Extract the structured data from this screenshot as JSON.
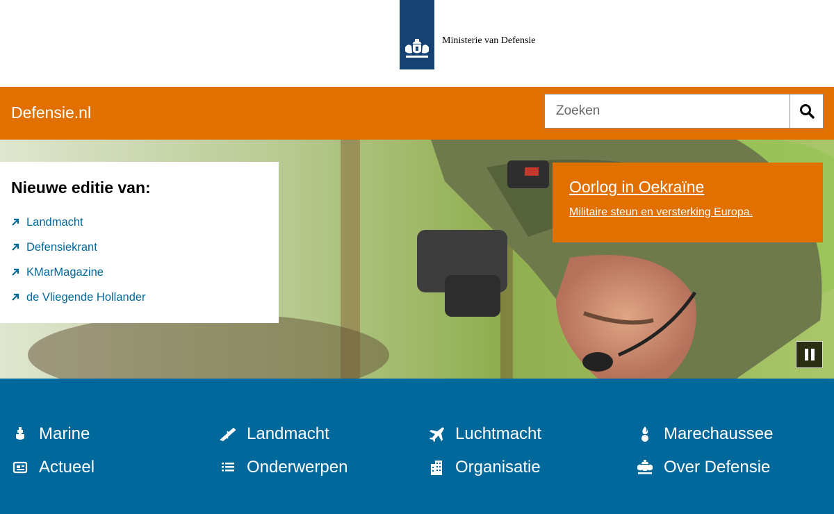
{
  "header": {
    "logo_text": "Ministerie van Defensie"
  },
  "navbar": {
    "site_title": "Defensie.nl",
    "search_placeholder": "Zoeken",
    "search_button_icon": "search-icon"
  },
  "hero": {
    "magazines_title": "Nieuwe editie van:",
    "magazines": [
      {
        "label": "Landmacht"
      },
      {
        "label": "Defensiekrant"
      },
      {
        "label": "KMarMagazine"
      },
      {
        "label": "de Vliegende Hollander"
      }
    ],
    "promo": {
      "title": "Oorlog in Oekraïne",
      "subtitle": "Militaire steun en versterking Europa."
    },
    "pause_icon": "pause-icon"
  },
  "bottom_nav": [
    {
      "label": "Marine",
      "icon": "marine-icon"
    },
    {
      "label": "Landmacht",
      "icon": "rifle-icon"
    },
    {
      "label": "Luchtmacht",
      "icon": "jet-icon"
    },
    {
      "label": "Marechaussee",
      "icon": "flame-grenade-icon"
    },
    {
      "label": "Actueel",
      "icon": "news-icon"
    },
    {
      "label": "Onderwerpen",
      "icon": "list-icon"
    },
    {
      "label": "Organisatie",
      "icon": "building-icon"
    },
    {
      "label": "Over Defensie",
      "icon": "crest-icon"
    }
  ],
  "colors": {
    "brand_orange": "#e17000",
    "rijks_blue": "#154273",
    "nav_blue": "#01689b",
    "link_blue": "#01689b"
  }
}
